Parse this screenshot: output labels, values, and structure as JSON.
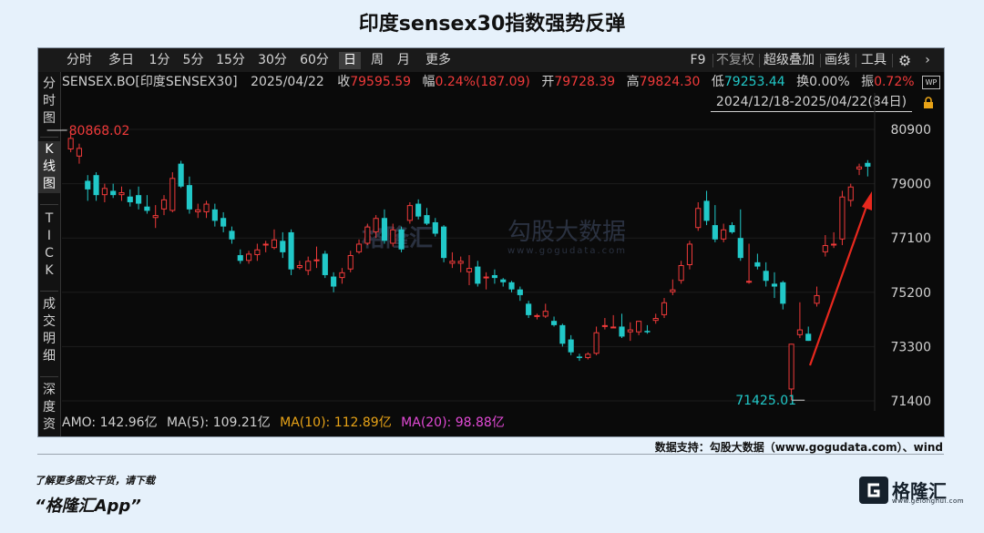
{
  "title": "印度sensex30指数强势反弹",
  "toolbar": {
    "periods": [
      "分时",
      "多日",
      "1分",
      "5分",
      "15分",
      "30分",
      "60分",
      "日",
      "周",
      "月",
      "更多"
    ],
    "active_period": "日",
    "right_items": [
      "F9",
      "不复权",
      "超级叠加",
      "画线",
      "工具"
    ]
  },
  "side_tabs": [
    {
      "label": "分时图",
      "active": false
    },
    {
      "label": "K线图",
      "active": true
    },
    {
      "label": "TICK",
      "active": false
    },
    {
      "label": "成交明细",
      "active": false
    },
    {
      "label": "深度资",
      "active": false
    }
  ],
  "info": {
    "symbol": "SENSEX.BO[印度SENSEX30]",
    "date": "2025/04/22",
    "close_label": "收",
    "close": "79595.59",
    "change_label": "幅",
    "change": "0.24%(187.09)",
    "open_label": "开",
    "open": "79728.39",
    "high_label": "高",
    "high": "79824.30",
    "low_label": "低",
    "low": "79253.44",
    "turnover_label": "换",
    "turnover": "0.00%",
    "amplitude_label": "振",
    "amplitude": "0.72%",
    "range": "2024/12/18-2025/04/22(84日)"
  },
  "annotations": {
    "high_mark": "80868.02",
    "low_mark": "71425.01"
  },
  "watermark": {
    "cn": "勾股大数据",
    "url": "www.gogudata.com",
    "logo_text": "格隆汇"
  },
  "volume_indicators": {
    "amo_label": "AMO: 142.96亿",
    "ma5_label": "MA(5): 109.21亿",
    "ma10_label": "MA(10): 112.89亿",
    "ma20_label": "MA(20): 98.88亿"
  },
  "colors": {
    "up": "#f03a3a",
    "down": "#21c8c8",
    "ma10": "#e8a317",
    "ma20": "#e24ad6",
    "arrow": "#e8281e"
  },
  "chart_data": {
    "type": "candlestick",
    "ylim": [
      71000,
      81500
    ],
    "yticks": [
      80900,
      79000,
      77100,
      75200,
      73300,
      71400
    ],
    "candles": [
      [
        80200,
        80868.02,
        80100,
        80600
      ],
      [
        79950,
        80400,
        79700,
        80250
      ],
      [
        79100,
        79300,
        78400,
        78800
      ],
      [
        79300,
        79400,
        78400,
        78600
      ],
      [
        78600,
        79000,
        78350,
        78850
      ],
      [
        78750,
        79000,
        78500,
        78600
      ],
      [
        78600,
        78900,
        78400,
        78700
      ],
      [
        78550,
        78800,
        78200,
        78350
      ],
      [
        78600,
        78900,
        78100,
        78300
      ],
      [
        78200,
        78600,
        77950,
        78050
      ],
      [
        77800,
        78250,
        77450,
        77900
      ],
      [
        78100,
        78600,
        77900,
        78450
      ],
      [
        78050,
        79400,
        78000,
        79200
      ],
      [
        79700,
        79800,
        78850,
        78900
      ],
      [
        78950,
        79250,
        77950,
        78100
      ],
      [
        78000,
        78300,
        77800,
        78100
      ],
      [
        78000,
        78400,
        77800,
        78300
      ],
      [
        78100,
        78300,
        77500,
        77700
      ],
      [
        77800,
        78000,
        77300,
        77500
      ],
      [
        77350,
        77500,
        76900,
        77050
      ],
      [
        76500,
        76700,
        76200,
        76300
      ],
      [
        76300,
        76650,
        76200,
        76550
      ],
      [
        76500,
        76900,
        76300,
        76700
      ],
      [
        76850,
        77000,
        76600,
        76900
      ],
      [
        76750,
        77400,
        76700,
        77050
      ],
      [
        77000,
        77300,
        76400,
        76600
      ],
      [
        77300,
        77400,
        75800,
        76000
      ],
      [
        76050,
        76300,
        76000,
        76150
      ],
      [
        75950,
        76450,
        75800,
        76300
      ],
      [
        76300,
        76800,
        76050,
        76350
      ],
      [
        76550,
        76650,
        75700,
        75800
      ],
      [
        75750,
        75900,
        75200,
        75400
      ],
      [
        75700,
        76050,
        75500,
        75900
      ],
      [
        76000,
        76650,
        75900,
        76500
      ],
      [
        76600,
        77050,
        76550,
        76900
      ],
      [
        76900,
        77600,
        76850,
        77500
      ],
      [
        77300,
        77900,
        77100,
        77800
      ],
      [
        77800,
        78100,
        76900,
        77000
      ],
      [
        76900,
        77600,
        76800,
        77400
      ],
      [
        77400,
        77500,
        76600,
        76700
      ],
      [
        77700,
        78350,
        77600,
        78250
      ],
      [
        78300,
        78450,
        77750,
        77850
      ],
      [
        77900,
        78150,
        77550,
        77600
      ],
      [
        77650,
        77800,
        77150,
        77250
      ],
      [
        77500,
        77550,
        76250,
        76400
      ],
      [
        76200,
        76600,
        76050,
        76300
      ],
      [
        76200,
        76450,
        75900,
        76300
      ],
      [
        75900,
        76500,
        75450,
        76050
      ],
      [
        76100,
        76300,
        75400,
        75500
      ],
      [
        75700,
        75900,
        75300,
        75750
      ],
      [
        75800,
        76000,
        75500,
        75700
      ],
      [
        75650,
        75700,
        75400,
        75550
      ],
      [
        75550,
        75600,
        75200,
        75300
      ],
      [
        75300,
        75400,
        74900,
        75100
      ],
      [
        74800,
        74900,
        74300,
        74400
      ],
      [
        74350,
        74450,
        74250,
        74400
      ],
      [
        74350,
        74800,
        74300,
        74550
      ],
      [
        74200,
        74350,
        74000,
        74050
      ],
      [
        74050,
        74100,
        73300,
        73400
      ],
      [
        73550,
        73700,
        73000,
        73100
      ],
      [
        72950,
        73050,
        72800,
        72900
      ],
      [
        72900,
        73100,
        72850,
        73050
      ],
      [
        73050,
        74000,
        73000,
        73800
      ],
      [
        74000,
        74300,
        73900,
        74050
      ],
      [
        74000,
        74400,
        73950,
        74000
      ],
      [
        74000,
        74450,
        73600,
        73650
      ],
      [
        73800,
        74150,
        73500,
        73900
      ],
      [
        73800,
        74200,
        73700,
        74200
      ],
      [
        73850,
        74050,
        73750,
        73800
      ],
      [
        74200,
        74450,
        74100,
        74300
      ],
      [
        74400,
        75000,
        74300,
        74850
      ],
      [
        75200,
        75650,
        75100,
        75300
      ],
      [
        75600,
        76300,
        75500,
        76150
      ],
      [
        76150,
        77000,
        76000,
        76900
      ],
      [
        77450,
        78350,
        77350,
        78150
      ],
      [
        78400,
        78750,
        77550,
        77700
      ],
      [
        77550,
        78250,
        76950,
        77050
      ],
      [
        77050,
        77600,
        76950,
        77400
      ],
      [
        77550,
        77650,
        77250,
        77300
      ],
      [
        77100,
        78100,
        76300,
        76400
      ],
      [
        75600,
        76900,
        75500,
        75600
      ],
      [
        76250,
        76550,
        76000,
        76100
      ],
      [
        75950,
        76250,
        75400,
        75600
      ],
      [
        75500,
        75900,
        75000,
        75400
      ],
      [
        75550,
        75600,
        74600,
        74800
      ],
      [
        71800,
        73400,
        71425.01,
        73400
      ],
      [
        73700,
        74850,
        73600,
        73900
      ],
      [
        73750,
        74000,
        73500,
        73500
      ],
      [
        74800,
        75400,
        74700,
        75100
      ],
      [
        76600,
        77200,
        76450,
        76850
      ],
      [
        76900,
        77300,
        76750,
        76900
      ],
      [
        77050,
        78750,
        76850,
        78550
      ],
      [
        78400,
        79000,
        78200,
        78900
      ],
      [
        79500,
        79700,
        79300,
        79600
      ],
      [
        79728.39,
        79824.3,
        79253.44,
        79595.59
      ]
    ]
  }
}
